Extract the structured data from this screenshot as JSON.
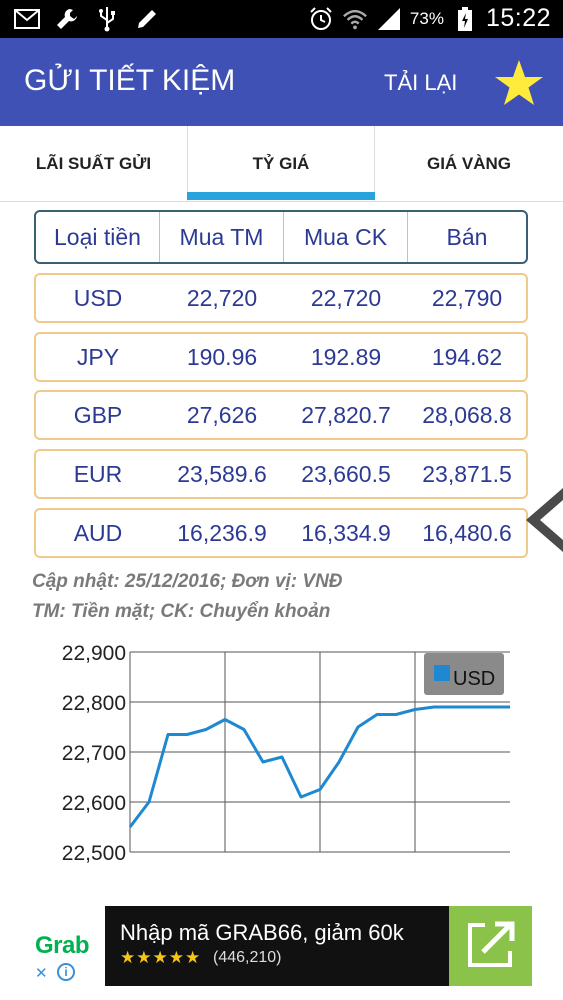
{
  "status_bar": {
    "icons_left": [
      "mail-icon",
      "wrench-icon",
      "usb-icon",
      "pencil-icon"
    ],
    "icons_right": [
      "alarm-icon",
      "wifi-icon",
      "signal-icon",
      "battery-icon"
    ],
    "battery": "73%",
    "time": "15:22"
  },
  "app_bar": {
    "title": "GỬI TIẾT KIỆM",
    "reload": "TẢI LẠI",
    "star_icon": "star-icon",
    "color": "#3f51b5",
    "star_color": "#ffeb3b"
  },
  "tabs": [
    {
      "label": "LÃI SUẤT GỬI",
      "active": false
    },
    {
      "label": "TỶ GIÁ",
      "active": true
    },
    {
      "label": "GIÁ VÀNG",
      "active": false
    }
  ],
  "rates": {
    "headers": [
      "Loại tiền",
      "Mua TM",
      "Mua CK",
      "Bán"
    ],
    "rows": [
      [
        "USD",
        "22,720",
        "22,720",
        "22,790"
      ],
      [
        "JPY",
        "190.96",
        "192.89",
        "194.62"
      ],
      [
        "GBP",
        "27,626",
        "27,820.7",
        "28,068.8"
      ],
      [
        "EUR",
        "23,589.6",
        "23,660.5",
        "23,871.5"
      ],
      [
        "AUD",
        "16,236.9",
        "16,334.9",
        "16,480.6"
      ]
    ]
  },
  "notes": {
    "line1": "Cập nhật: 25/12/2016;  Đơn vị: VNĐ",
    "line2": "TM: Tiền mặt; CK: Chuyển khoản"
  },
  "chart_data": {
    "type": "line",
    "series": [
      {
        "name": "USD",
        "color": "#1e88d0",
        "values": [
          22550,
          22600,
          22735,
          22735,
          22745,
          22765,
          22745,
          22680,
          22690,
          22610,
          22625,
          22680,
          22750,
          22775,
          22775,
          22785,
          22790,
          22790,
          22790,
          22790,
          22790
        ]
      }
    ],
    "ylim": [
      22500,
      22900
    ],
    "yticks": [
      "22,900",
      "22,800",
      "22,700",
      "22,600",
      "22,500"
    ],
    "grid": true,
    "legend": "top-right"
  },
  "ad": {
    "logo": "Grab",
    "headline": "Nhập mã GRAB66, giảm 60k",
    "stars": "★★★★★",
    "rating_count": "(446,210)",
    "close": "✕",
    "info": "i",
    "open_icon": "open-external-icon"
  }
}
